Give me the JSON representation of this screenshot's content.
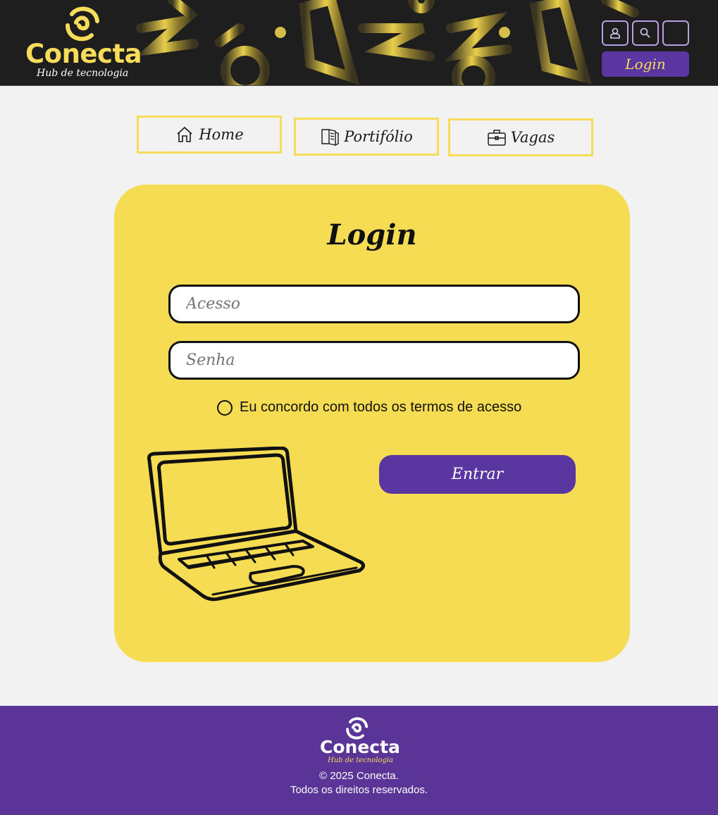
{
  "header": {
    "logo": {
      "name": "Conecta",
      "tagline": "Hub de tecnologia"
    },
    "icons": [
      "user-icon",
      "search-icon",
      "empty-icon"
    ],
    "login_label": "Login"
  },
  "nav": [
    {
      "label": "Home",
      "icon": "home-icon"
    },
    {
      "label": "Portifólio",
      "icon": "portfolio-icon"
    },
    {
      "label": "Vagas",
      "icon": "briefcase-icon"
    }
  ],
  "login_form": {
    "title": "Login",
    "access_placeholder": "Acesso",
    "password_placeholder": "Senha",
    "terms_label": "Eu concordo com todos os termos de acesso",
    "submit_label": "Entrar"
  },
  "footer": {
    "logo": {
      "name": "Conecta",
      "tagline": "Hub de tecnologia"
    },
    "copyright": "© 2025 Conecta.",
    "rights": "Todos os direitos reservados."
  },
  "colors": {
    "yellow": "#f6dc52",
    "purple": "#5a36a0",
    "header_bg": "#1e1e1e",
    "page_bg": "#f2f2f2"
  }
}
